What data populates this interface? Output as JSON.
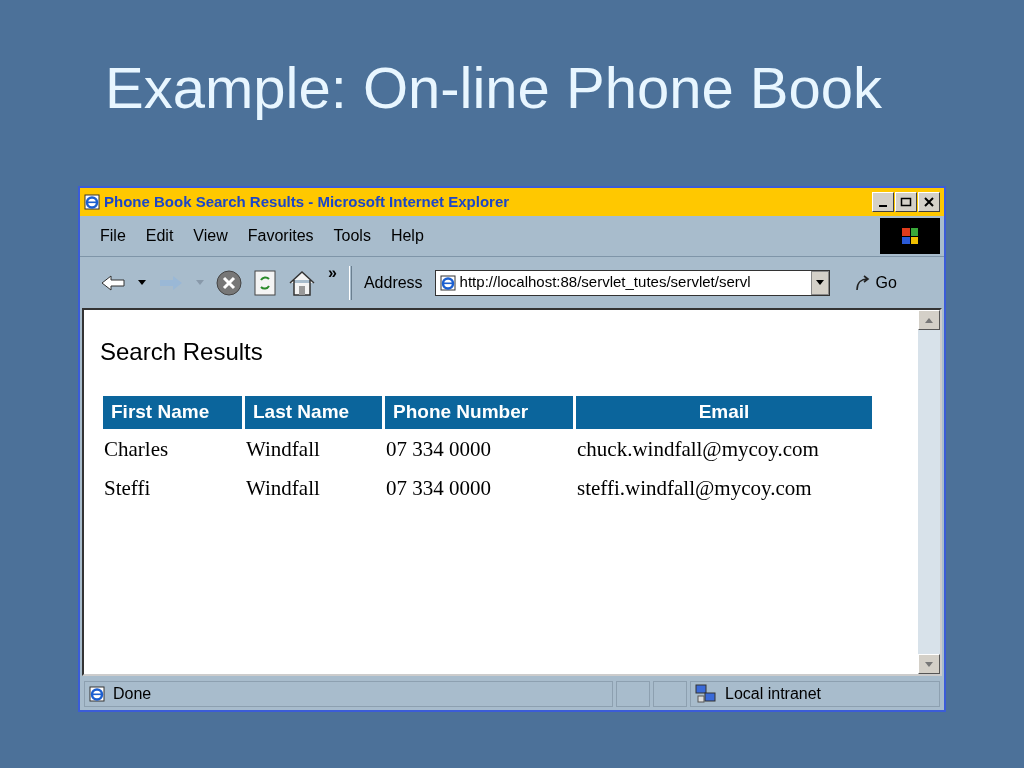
{
  "slide": {
    "title": "Example: On-line Phone Book"
  },
  "window": {
    "title": "Phone Book Search Results - Microsoft Internet Explorer"
  },
  "menu": [
    "File",
    "Edit",
    "View",
    "Favorites",
    "Tools",
    "Help"
  ],
  "toolbar": {
    "chevron": "»",
    "address_label": "Address",
    "address": "http://localhost:88/servlet_tutes/servlet/servl",
    "go": "Go"
  },
  "page": {
    "heading": "Search Results",
    "table": {
      "columns": [
        "First Name",
        "Last Name",
        "Phone Number",
        "Email"
      ],
      "rows": [
        [
          "Charles",
          "Windfall",
          "07 334 0000",
          "chuck.windfall@mycoy.com"
        ],
        [
          "Steffi",
          "Windfall",
          "07 334 0000",
          "steffi.windfall@mycoy.com"
        ]
      ]
    }
  },
  "status_bar": {
    "text": "Done",
    "zone": "Local intranet"
  }
}
